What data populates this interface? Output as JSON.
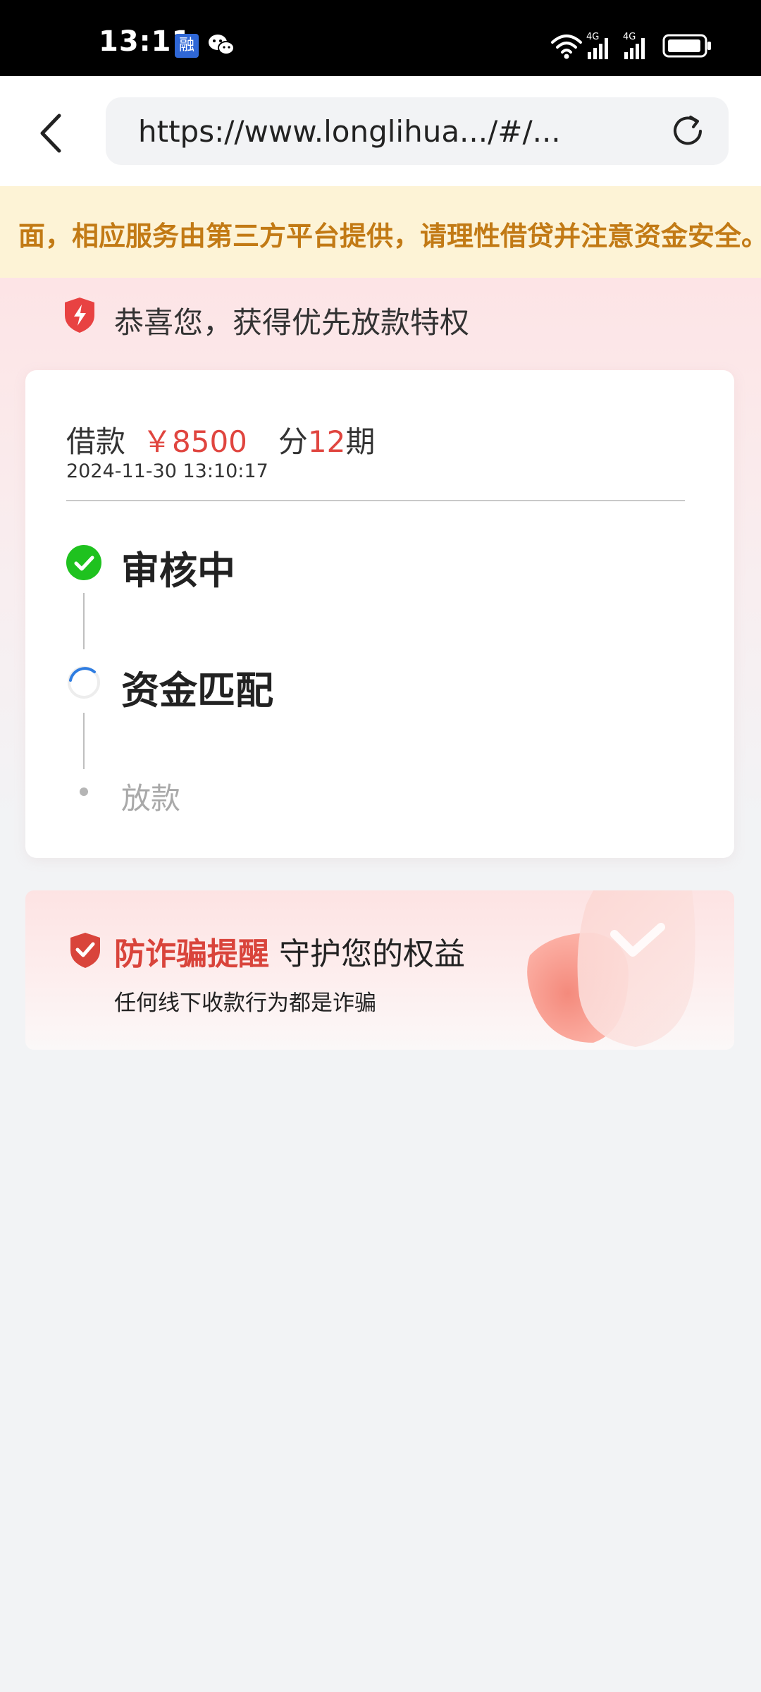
{
  "status_bar": {
    "time": "13:11",
    "app_badge": "融",
    "icons": [
      "wechat-icon",
      "wifi-icon",
      "signal-4g-icon",
      "signal-4g-icon",
      "battery-icon"
    ],
    "network_label_1": "4G",
    "network_label_2": "4G"
  },
  "browser": {
    "url": "https://www.longlihua.../#/...",
    "back_icon": "back-arrow-icon",
    "reload_icon": "reload-icon"
  },
  "notice": {
    "text": "面，相应服务由第三方平台提供，请理性借贷并注意资金安全。"
  },
  "congrats": {
    "text": "恭喜您，获得优先放款特权"
  },
  "loan": {
    "label": "借款",
    "amount": "￥8500",
    "term_prefix": "分",
    "term_count": "12",
    "term_suffix": "期",
    "timestamp": "2024-11-30 13:10:17"
  },
  "steps": [
    {
      "label": "审核中",
      "status": "done"
    },
    {
      "label": "资金匹配",
      "status": "in_progress"
    },
    {
      "label": "放款",
      "status": "pending"
    }
  ],
  "anti_fraud": {
    "title_red": "防诈骗提醒",
    "title_dark": "守护您的权益",
    "subtitle": "任何线下收款行为都是诈骗"
  },
  "colors": {
    "accent_red": "#e0453f",
    "notice_text": "#c27a15",
    "notice_bg": "#fdf3d6",
    "success_green": "#1fc21f",
    "spinner_blue": "#2f7de1"
  }
}
